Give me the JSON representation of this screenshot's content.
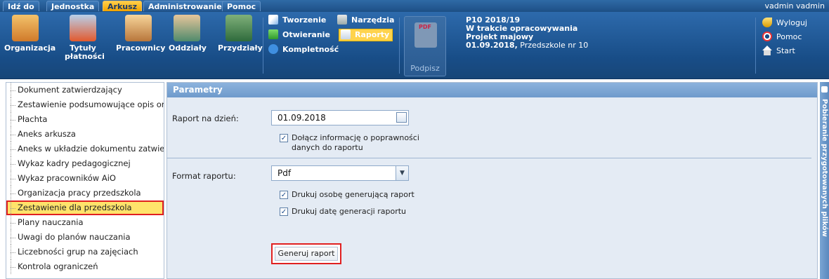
{
  "menubar": {
    "tabs": [
      {
        "label": "Idź do",
        "active": false
      },
      {
        "label": "Jednostka",
        "active": false
      },
      {
        "label": "Arkusz",
        "active": true
      },
      {
        "label": "Administrowanie",
        "active": false
      },
      {
        "label": "Pomoc",
        "active": false
      }
    ],
    "user": "vadmin vadmin"
  },
  "ribbon": {
    "buttons": [
      {
        "label": "Organizacja",
        "icon": "building-icon"
      },
      {
        "label": "Tytuły płatności",
        "icon": "payment-titles-icon"
      },
      {
        "label": "Pracownicy",
        "icon": "employees-icon"
      },
      {
        "label": "Oddziały",
        "icon": "classes-icon"
      },
      {
        "label": "Przydziały",
        "icon": "assignments-icon"
      }
    ],
    "menu": {
      "tworzenie": "Tworzenie",
      "otwieranie": "Otwieranie",
      "kompletnosc": "Kompletność",
      "narzedzia": "Narzędzia",
      "raporty": "Raporty"
    },
    "podpisz": "Podpisz",
    "info": {
      "line1": "P10 2018/19",
      "line2": "W trakcie opracowywania",
      "line3": "Projekt majowy",
      "line4_date": "01.09.2018,",
      "line4_rest": "Przedszkole nr 10"
    },
    "right_links": {
      "wyloguj": "Wyloguj",
      "pomoc": "Pomoc",
      "start": "Start"
    }
  },
  "tree": {
    "items": [
      {
        "label": "Dokument zatwierdzający"
      },
      {
        "label": "Zestawienie podsumowujące opis org"
      },
      {
        "label": "Płachta"
      },
      {
        "label": "Aneks arkusza"
      },
      {
        "label": "Aneks w układzie dokumentu zatwierd"
      },
      {
        "label": "Wykaz kadry pedagogicznej"
      },
      {
        "label": "Wykaz pracowników AiO"
      },
      {
        "label": "Organizacja pracy przedszkola"
      },
      {
        "label": "Zestawienie dla przedszkola",
        "selected": true
      },
      {
        "label": "Plany nauczania"
      },
      {
        "label": "Uwagi do planów nauczania"
      },
      {
        "label": "Liczebności grup na zajęciach"
      },
      {
        "label": "Kontrola ograniczeń"
      }
    ]
  },
  "panel": {
    "title": "Parametry",
    "raport_label": "Raport na dzień:",
    "raport_date": "01.09.2018",
    "dolacz_line1": "Dołącz informację o poprawności",
    "dolacz_line2": "danych do raportu",
    "dolacz_checked": true,
    "format_label": "Format raportu:",
    "format_value": "Pdf",
    "drukuj_osobe": "Drukuj osobę generującą raport",
    "drukuj_osobe_checked": true,
    "drukuj_date": "Drukuj datę generacji raportu",
    "drukuj_date_checked": true,
    "generate_button": "Generuj raport"
  },
  "side_panel": {
    "label": "Pobieranie przygotowanych plików"
  },
  "colors": {
    "accent": "#f2a300",
    "ribbon": "#184d87",
    "selection_outline": "#e02020"
  }
}
